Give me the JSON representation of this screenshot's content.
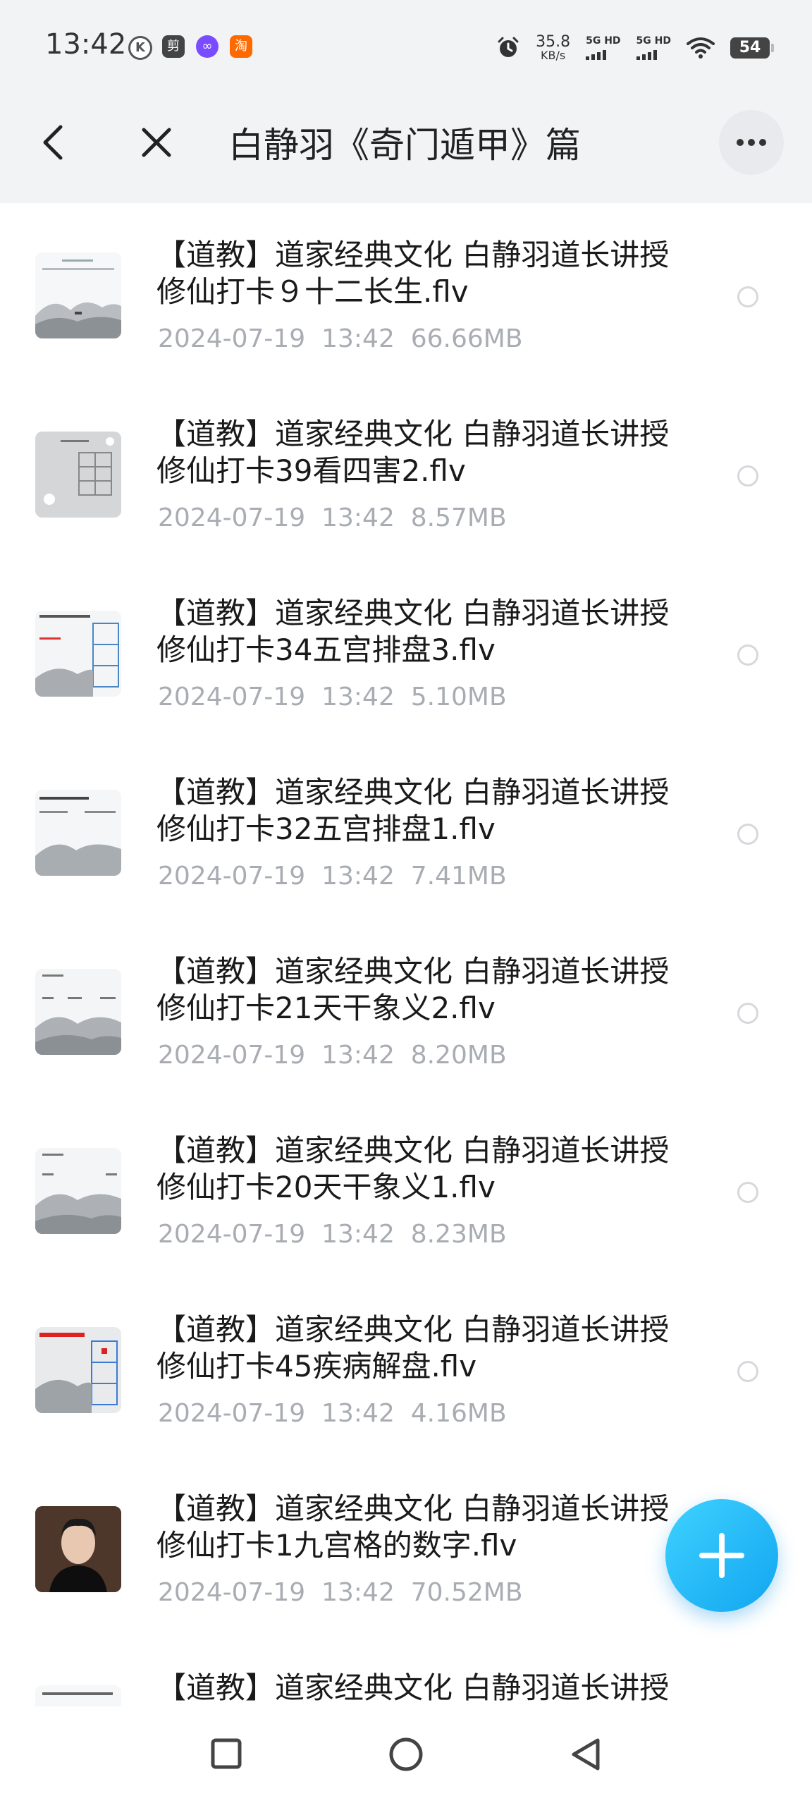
{
  "status_bar": {
    "time": "13:42",
    "app_icons": [
      "K",
      "剪",
      "∞",
      "淘"
    ],
    "net_speed_value": "35.8",
    "net_speed_unit": "KB/s",
    "sim1_label": "5G HD",
    "sim2_label": "5G HD",
    "battery": "54"
  },
  "app_bar": {
    "title": "白静羽《奇门遁甲》篇"
  },
  "files": [
    {
      "name": "【道教】道家经典文化 白静羽道长讲授修仙打卡９十二长生.flv",
      "date": "2024-07-19",
      "time": "13:42",
      "size": "66.66MB",
      "thumb": "landscape-text"
    },
    {
      "name": "【道教】道家经典文化 白静羽道长讲授修仙打卡39看四害2.flv",
      "date": "2024-07-19",
      "time": "13:42",
      "size": "8.57MB",
      "thumb": "gray-grid"
    },
    {
      "name": "【道教】道家经典文化 白静羽道长讲授修仙打卡34五宫排盘3.flv",
      "date": "2024-07-19",
      "time": "13:42",
      "size": "5.10MB",
      "thumb": "landscape-chart"
    },
    {
      "name": "【道教】道家经典文化 白静羽道长讲授修仙打卡32五宫排盘1.flv",
      "date": "2024-07-19",
      "time": "13:42",
      "size": "7.41MB",
      "thumb": "landscape-text"
    },
    {
      "name": "【道教】道家经典文化 白静羽道长讲授修仙打卡21天干象义2.flv",
      "date": "2024-07-19",
      "time": "13:42",
      "size": "8.20MB",
      "thumb": "landscape-text"
    },
    {
      "name": "【道教】道家经典文化 白静羽道长讲授修仙打卡20天干象义1.flv",
      "date": "2024-07-19",
      "time": "13:42",
      "size": "8.23MB",
      "thumb": "landscape-text"
    },
    {
      "name": "【道教】道家经典文化 白静羽道长讲授修仙打卡45疾病解盘.flv",
      "date": "2024-07-19",
      "time": "13:42",
      "size": "4.16MB",
      "thumb": "landscape-chart-red"
    },
    {
      "name": "【道教】道家经典文化 白静羽道长讲授修仙打卡1九宫格的数字.flv",
      "date": "2024-07-19",
      "time": "13:42",
      "size": "70.52MB",
      "thumb": "person"
    },
    {
      "name": "【道教】道家经典文化 白静羽道长讲授",
      "date": "",
      "time": "",
      "size": "",
      "thumb": "landscape-text"
    }
  ],
  "icons": {
    "back": "chevron-left-icon",
    "close": "close-icon",
    "more": "more-horizontal-icon",
    "fab": "plus-icon",
    "nav": [
      "square-recents-icon",
      "circle-home-icon",
      "triangle-back-icon"
    ]
  },
  "colors": {
    "header_bg": "#f2f3f5",
    "fab_start": "#3fd2ff",
    "fab_end": "#12a5f0",
    "meta_text": "#a9adb3"
  }
}
